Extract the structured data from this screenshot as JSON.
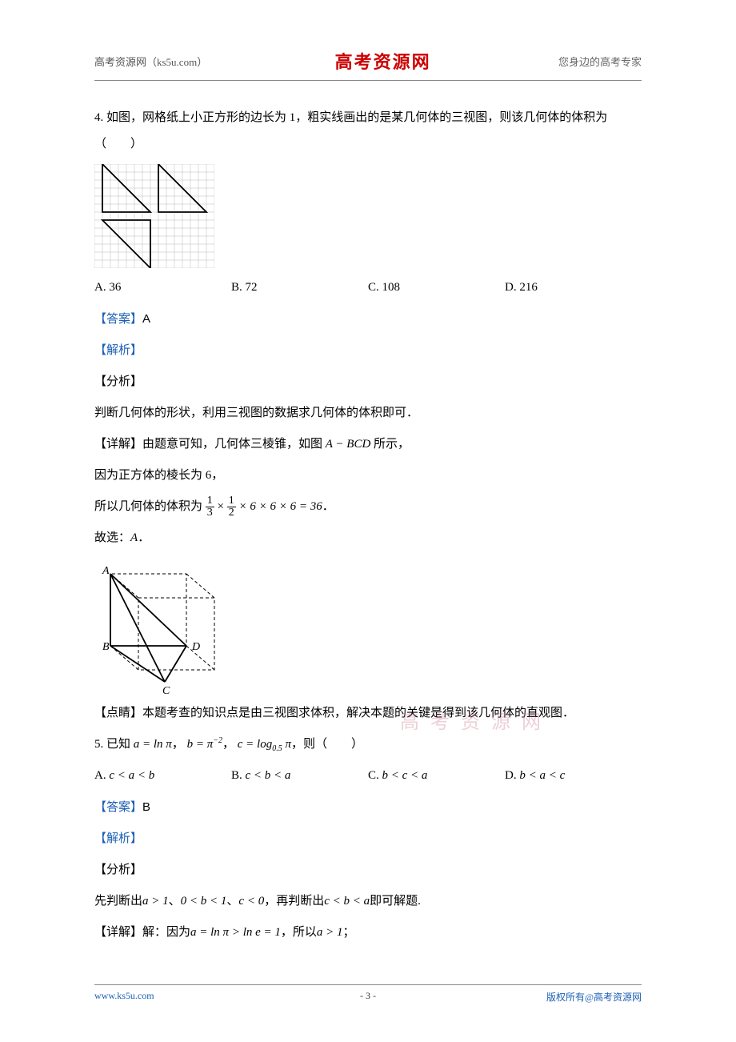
{
  "header": {
    "left": "高考资源网（ks5u.com）",
    "center": "高考资源网",
    "right": "您身边的高考专家"
  },
  "q4": {
    "num": "4.",
    "stem": "如图，网格纸上小正方形的边长为 1，粗实线画出的是某几何体的三视图，则该几何体的体积为（　　）",
    "options": {
      "A": "A. 36",
      "B": "B. 72",
      "C": "C. 108",
      "D": "D. 216"
    },
    "answer_label": "【答案】",
    "answer_val": "A",
    "jiexi_label": "【解析】",
    "fenxi_label": "【分析】",
    "fenxi_text": "判断几何体的形状，利用三视图的数据求几何体的体积即可．",
    "xiangjie_prefix": "【详解】由题意可知，几何体三棱锥，如图 ",
    "xiangjie_mid": "A − BCD",
    "xiangjie_suffix": " 所示，",
    "line_cube": "因为正方体的棱长为 6，",
    "vol_prefix": "所以几何体的体积为",
    "vol_suffix": "．",
    "frac1_num": "1",
    "frac1_den": "3",
    "frac2_num": "1",
    "frac2_den": "2",
    "vol_tail": "× 6 × 6 × 6 = 36",
    "guxuan": "故选：",
    "guxuan_ans": "A",
    "guxuan_dot": "．",
    "dianjing": "【点睛】本题考查的知识点是由三视图求体积，解决本题的关键是得到该几何体的直观图．"
  },
  "q5": {
    "num": "5.",
    "stem_prefix": "已知 ",
    "a_eq": "a = ln π",
    "comma1": "，",
    "b_eq": "b = π",
    "b_exp": "−2",
    "comma2": "，",
    "c_eq_pre": "c = log",
    "c_sub": "0.5",
    "c_eq_post": " π",
    "stem_suffix": "，则（　　）",
    "options": {
      "A": {
        "label": "A.",
        "math": "c < a < b"
      },
      "B": {
        "label": "B.",
        "math": "c < b < a"
      },
      "C": {
        "label": "C.",
        "math": "b < c < a"
      },
      "D": {
        "label": "D.",
        "math": "b < a < c"
      }
    },
    "answer_label": "【答案】",
    "answer_val": "B",
    "jiexi_label": "【解析】",
    "fenxi_label": "【分析】",
    "fenxi_prefix": "先判断出",
    "fenxi_a": "a > 1",
    "fenxi_sep1": "、",
    "fenxi_b": "0 < b < 1",
    "fenxi_sep2": "、",
    "fenxi_c": "c < 0",
    "fenxi_mid": "，再判断出",
    "fenxi_cba": "c < b < a",
    "fenxi_suffix": "即可解题.",
    "xiangjie_prefix": "【详解】解：因为",
    "xiangjie_math": "a = ln π > ln e = 1",
    "xiangjie_mid": "，所以",
    "xiangjie_a": "a > 1",
    "xiangjie_suffix": "；"
  },
  "labels_3d": {
    "A": "A",
    "B": "B",
    "C": "C",
    "D": "D"
  },
  "watermark": "高 考 资 源 网",
  "footer": {
    "left": "www.ks5u.com",
    "center": "- 3 -",
    "right": "版权所有@高考资源网"
  }
}
